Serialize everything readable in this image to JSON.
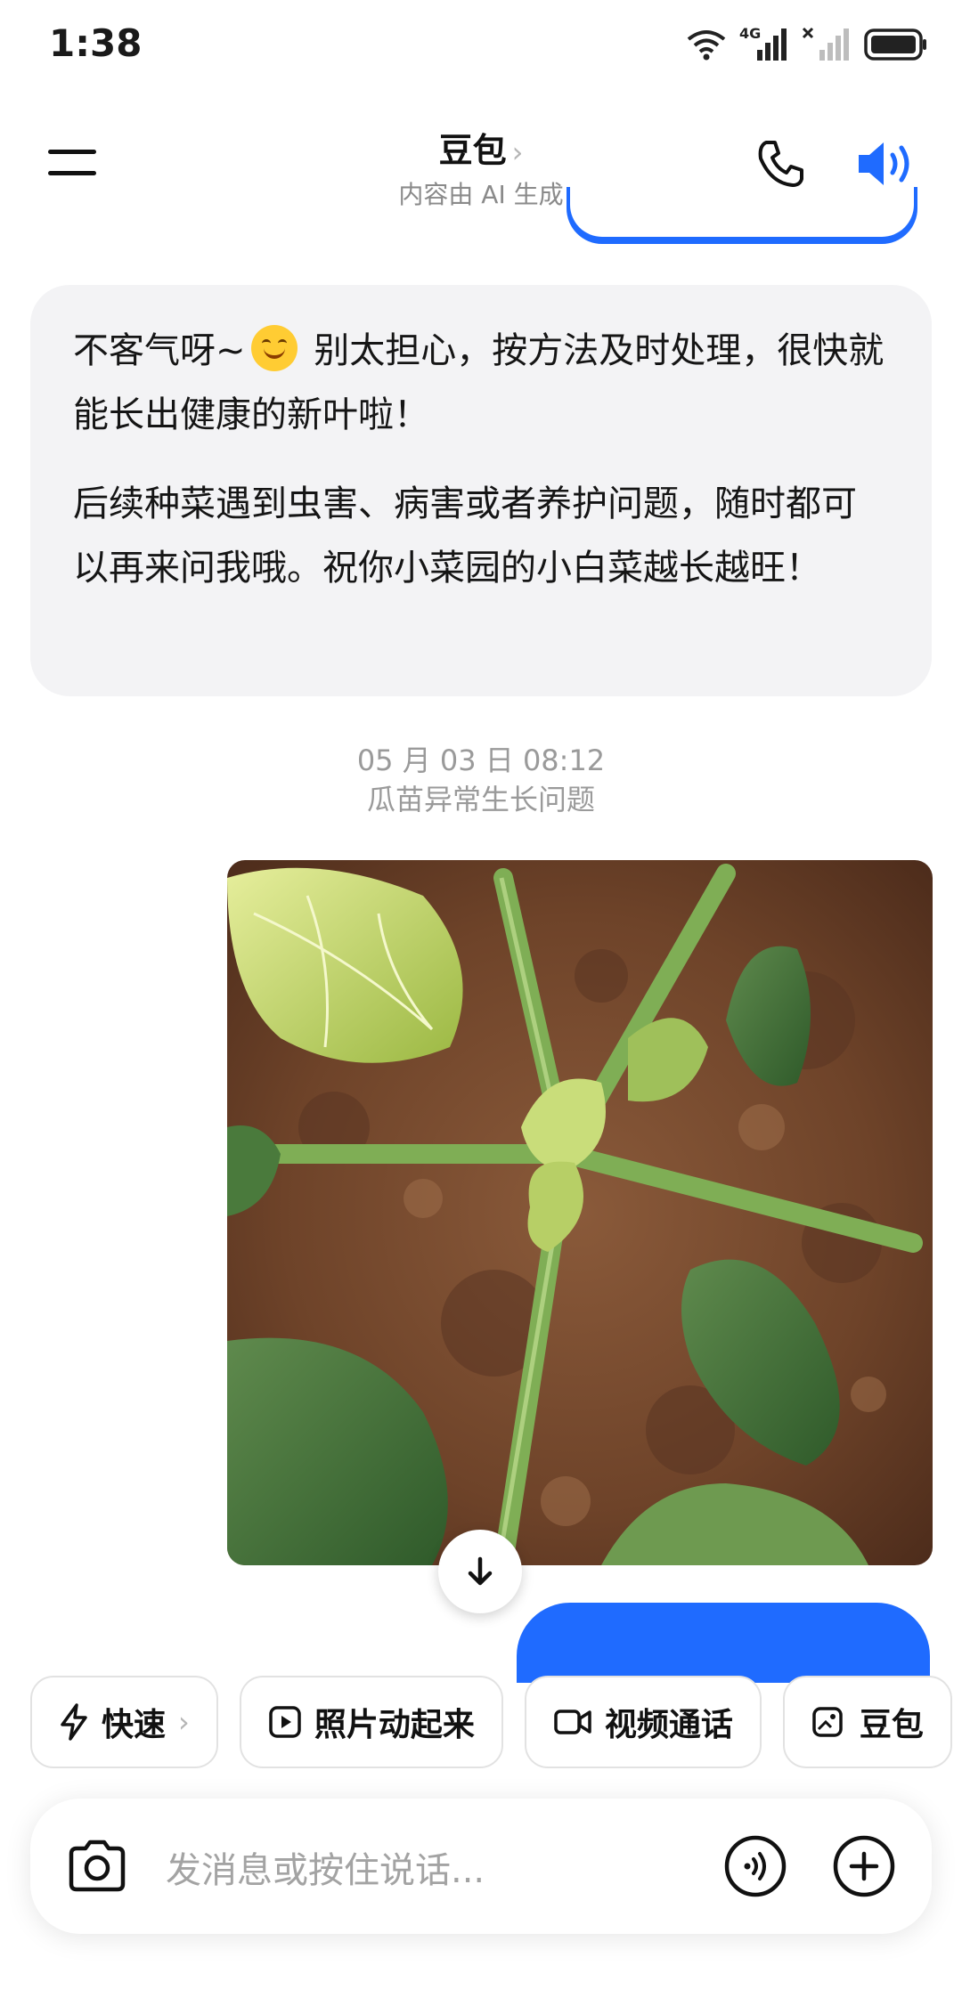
{
  "status_bar": {
    "time": "1:38",
    "network_label": "4G"
  },
  "header": {
    "title": "豆包",
    "title_chevron": "›",
    "subtitle": "内容由 AI 生成",
    "icons": [
      "menu-icon",
      "phone-icon",
      "speaker-icon"
    ]
  },
  "conversation": {
    "assistant_message": {
      "line1_before_emoji": "不客气呀~",
      "emoji": "smiling-face-emoji",
      "line1_after_emoji": " 别太担心，按方法及时处理，很快就能长出健康的新叶啦！",
      "paragraph2": "后续种菜遇到虫害、病害或者养护问题，随时都可以再来问我哦。祝你小菜园的小白菜越长越旺！"
    },
    "timestamp": "05 月 03 日 08:12",
    "topic": "瓜苗异常生长问题",
    "image_description_icon": "plant-photo"
  },
  "quick_actions": [
    {
      "label": "快速",
      "icon": "lightning-icon",
      "has_chevron": true,
      "chevron": "›"
    },
    {
      "label": "照片动起来",
      "icon": "play-square-icon"
    },
    {
      "label": "视频通话",
      "icon": "video-camera-icon"
    },
    {
      "label": "豆包",
      "icon": "image-edit-icon"
    }
  ],
  "input": {
    "placeholder": "发消息或按住说话..."
  },
  "colors": {
    "accent": "#1f6bff",
    "bubble_bg": "#f3f3f5"
  }
}
